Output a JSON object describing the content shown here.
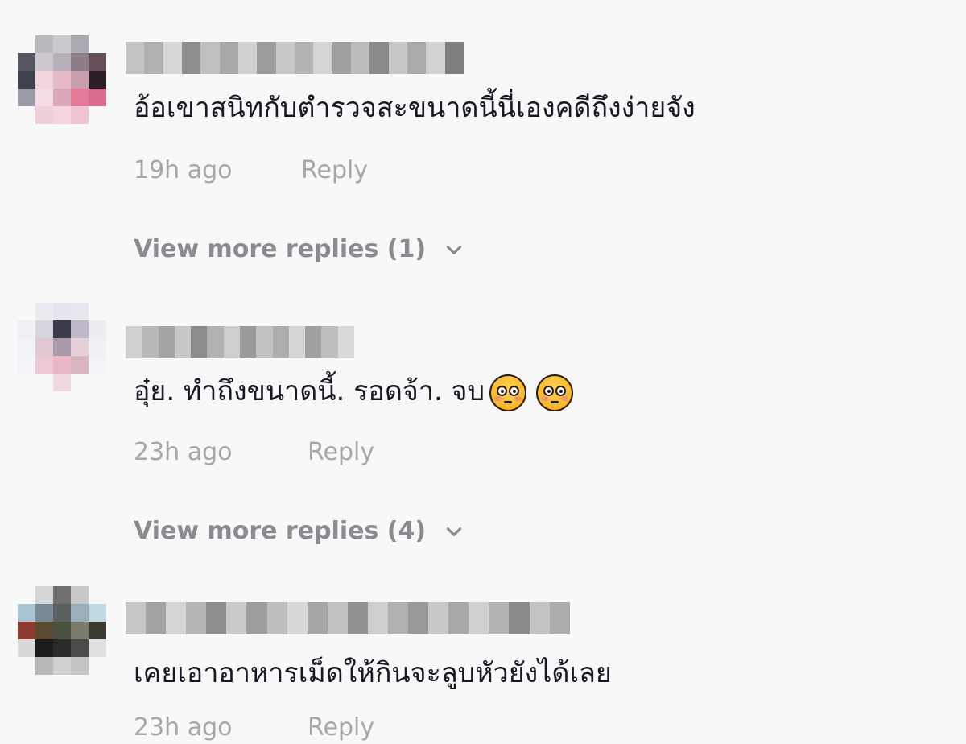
{
  "comments": [
    {
      "text": "อ้อเขาสนิทกับตำรวจสะขนาดนี้นี่เองคดีถึงง่ายจัง",
      "time": "19h ago",
      "reply_label": "Reply",
      "view_more": "View more replies (1)",
      "avatar_colors": [
        "#f8f8f8",
        "#b9b9bf",
        "#c9c9ce",
        "#a9a9b1",
        "#f8f8f8",
        "#555660",
        "#cfc8d0",
        "#b7b0b8",
        "#8b7c88",
        "#65505a",
        "#3e4250",
        "#efd4dc",
        "#e8b9c8",
        "#c99fad",
        "#2b1e26",
        "#9a9aa6",
        "#f4dbe4",
        "#d9a7b8",
        "#e07c98",
        "#d86c8c",
        "#f8f8f8",
        "#efd0da",
        "#f5d6e0",
        "#f0c4d2",
        "#f8f8f8"
      ],
      "username_colors": [
        "#c4c4c6",
        "#b0b0b2",
        "#d8d8da",
        "#8e8e90",
        "#c0c0c2",
        "#a8a8aa",
        "#d0d0d2",
        "#9c9c9e",
        "#c8c8ca",
        "#b4b4b6",
        "#d4d4d6",
        "#a0a0a2",
        "#bcbcbe",
        "#8a8a8c",
        "#c6c6c8",
        "#aaaaac",
        "#d2d2d4",
        "#7e7e80"
      ]
    },
    {
      "text": "อุ๋ย. ทำถึงขนาดนี้. รอดจ้า. จบ",
      "time": "23h ago",
      "reply_label": "Reply",
      "view_more": "View more replies (4)",
      "emoji": "flushed-face",
      "avatar_colors": [
        "#f8f8f8",
        "#eaeaf0",
        "#e6e6ec",
        "#e8e8ee",
        "#f8f8f8",
        "#f0f0f4",
        "#d6d6de",
        "#3b3a48",
        "#bfb8c6",
        "#ececf2",
        "#f2f2f6",
        "#e0c8d2",
        "#a89aa8",
        "#e6d0da",
        "#f0f0f4",
        "#f4f4f8",
        "#ecc8d4",
        "#e8b8c8",
        "#dcb4c0",
        "#f4f4f8",
        "#f8f8f8",
        "#f8f8f8",
        "#efd8e0",
        "#f8f8f8",
        "#f8f8f8"
      ],
      "username_colors": [
        "#d0d0d2",
        "#b8b8ba",
        "#a4a4a6",
        "#c6c6c8",
        "#8c8c8e",
        "#b2b2b4",
        "#cfcfd1",
        "#9a9a9c",
        "#c2c2c4",
        "#aeaeb0",
        "#d6d6d8",
        "#a0a0a2",
        "#bebec0",
        "#dadadc"
      ]
    },
    {
      "text": "เคยเอาอาหารเม็ดให้กินจะลูบหัวยังได้เลย",
      "time": "23h ago",
      "reply_label": "Reply",
      "avatar_colors": [
        "#f8f8f8",
        "#d6d6d8",
        "#707070",
        "#c8c8c8",
        "#f8f8f8",
        "#a8c4d4",
        "#7a8a94",
        "#5a6060",
        "#9ab0bc",
        "#c0d8e4",
        "#8a3a30",
        "#5a4a30",
        "#4a5040",
        "#7a7a6a",
        "#3a3a30",
        "#d8d8d8",
        "#1c1c1c",
        "#2a2a2a",
        "#4a4a4a",
        "#e0e0e0",
        "#f8f8f8",
        "#b8b8b8",
        "#d0d0d0",
        "#c4c4c4",
        "#f8f8f8"
      ],
      "username_colors": [
        "#c6c6c8",
        "#a2a2a4",
        "#d4d4d6",
        "#b6b6b8",
        "#8e8e90",
        "#cacacc",
        "#9e9ea0",
        "#bebec0",
        "#d8d8da",
        "#a6a6a8",
        "#c2c2c4",
        "#929294",
        "#cececf",
        "#b0b0b2",
        "#9a9a9c",
        "#c8c8ca",
        "#a8a8aa",
        "#d0d0d2",
        "#b4b4b6",
        "#8a8a8c",
        "#c4c4c6",
        "#acacae"
      ]
    }
  ],
  "icons": {
    "chevron": "chevron-down-icon",
    "emoji": "flushed-face-icon"
  }
}
